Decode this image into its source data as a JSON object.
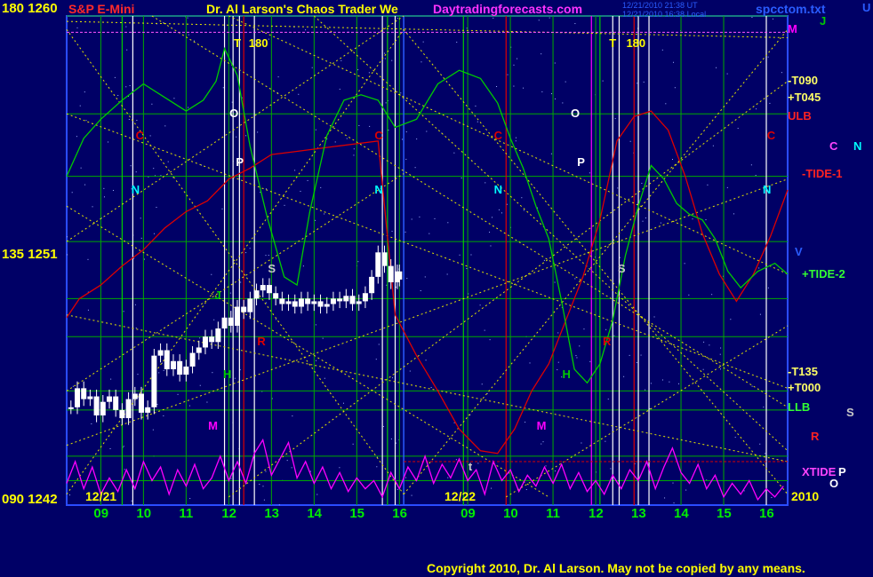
{
  "header": {
    "axis_top": "180 1260",
    "instrument": "S&P E-Mini",
    "title": "Dr. Al Larson's Chaos Trader We",
    "site": "Daytradingforecasts.com",
    "timestamp_ut": "12/21/2010 21:38 UT",
    "timestamp_local": "12/21/2010 16:38 Local",
    "file": "spcctom.txt"
  },
  "y_labels": {
    "top": "180 1260",
    "mid": "135 1251",
    "bottom": "090 1242"
  },
  "date_labels": {
    "left": "12/21",
    "right": "12/22",
    "year": "2010"
  },
  "footer": {
    "copyright": "Copyright 2010, Dr. Al Larson. May not be copied by any means."
  },
  "colors": {
    "background": "#000066",
    "grid": "#00aa00",
    "price": "#ffffff",
    "green_line": "#00cc00",
    "red_line": "#dd0000",
    "magenta_line": "#ff00ff",
    "dotted_fan": "#e6e600"
  },
  "chart_data": {
    "type": "line",
    "title": "Dr. Al Larson's Chaos Trader We",
    "instrument": "S&P E-Mini",
    "y_axis": {
      "range": [
        1242,
        1260
      ],
      "ticks": [
        1242,
        1251,
        1260
      ],
      "angle_ticks": [
        "090",
        "135",
        "180"
      ]
    },
    "x_axis": {
      "unit": "hour",
      "range": [
        8.2,
        17.2
      ],
      "tick_labels": [
        "09",
        "10",
        "11",
        "12",
        "13",
        "14",
        "15",
        "16",
        "09",
        "10",
        "11",
        "12",
        "13",
        "14",
        "15",
        "16"
      ],
      "ticks_day1": [
        9,
        10,
        11,
        12,
        13,
        14,
        15,
        16
      ],
      "ticks_day2": [
        9,
        10,
        11,
        12,
        13,
        14,
        15,
        16
      ],
      "day_split": 16.1
    },
    "grid": true,
    "horizontal_grid_values": [
      1243.8,
      1249.6,
      1251.7,
      1254.1,
      1256.4,
      1260,
      1245.5,
      1242.9,
      1248.2,
      1246.2
    ],
    "price_series": {
      "name": "S&P E-Mini",
      "x": [
        8.3,
        8.45,
        8.6,
        8.75,
        8.9,
        9.05,
        9.2,
        9.35,
        9.5,
        9.65,
        9.8,
        9.95,
        10.1,
        10.25,
        10.4,
        10.55,
        10.7,
        10.85,
        11.0,
        11.15,
        11.3,
        11.45,
        11.6,
        11.75,
        11.9,
        12.05,
        12.2,
        12.35,
        12.5,
        12.65,
        12.8,
        12.95,
        13.1,
        13.25,
        13.4,
        13.55,
        13.7,
        13.85,
        14.0,
        14.15,
        14.3,
        14.45,
        14.6,
        14.75,
        14.9,
        15.05,
        15.2,
        15.35,
        15.5,
        15.65,
        15.8,
        15.95,
        16.0
      ],
      "values": [
        1245.6,
        1246.3,
        1245.9,
        1246.0,
        1245.3,
        1245.8,
        1246.0,
        1245.5,
        1245.2,
        1245.9,
        1246.1,
        1245.4,
        1245.6,
        1247.5,
        1247.7,
        1247.0,
        1247.3,
        1246.8,
        1247.1,
        1247.6,
        1247.8,
        1248.2,
        1248.0,
        1248.5,
        1248.9,
        1248.6,
        1249.3,
        1249.1,
        1249.6,
        1249.9,
        1250.1,
        1249.8,
        1249.6,
        1249.4,
        1249.5,
        1249.3,
        1249.6,
        1249.4,
        1249.5,
        1249.3,
        1249.4,
        1249.6,
        1249.5,
        1249.7,
        1249.4,
        1249.5,
        1249.8,
        1250.4,
        1251.3,
        1250.8,
        1250.2,
        1250.6,
        1250.3
      ]
    },
    "green_line": {
      "x": [
        8.2,
        8.6,
        9.0,
        9.5,
        10.0,
        10.5,
        11.0,
        11.4,
        11.7,
        11.9,
        12.2,
        12.5,
        12.9,
        13.3,
        13.6,
        13.9,
        14.3,
        14.7,
        15.1,
        15.5,
        15.9,
        16.4,
        16.9,
        17.4,
        17.9,
        18.3,
        18.6,
        18.9,
        19.2,
        19.5,
        19.8,
        20.1,
        20.4,
        20.7,
        21.0,
        21.3,
        21.6,
        21.9,
        22.2,
        22.5,
        22.8,
        23.1,
        23.4,
        23.7,
        24.0,
        24.4,
        24.8,
        25.1
      ],
      "values": [
        1254.1,
        1255.5,
        1256.2,
        1256.9,
        1257.5,
        1257.0,
        1256.5,
        1256.9,
        1257.6,
        1258.8,
        1257.8,
        1255.2,
        1252.6,
        1250.4,
        1250.1,
        1252.8,
        1255.6,
        1256.9,
        1257.1,
        1256.9,
        1255.9,
        1256.2,
        1257.5,
        1258.0,
        1257.7,
        1256.8,
        1255.5,
        1254.4,
        1253.0,
        1251.8,
        1249.5,
        1247.0,
        1246.5,
        1247.2,
        1248.8,
        1251.2,
        1253.0,
        1254.5,
        1254.0,
        1253.1,
        1252.7,
        1252.5,
        1251.8,
        1250.6,
        1250.0,
        1250.6,
        1250.9,
        1250.5
      ]
    },
    "red_line": {
      "x": [
        8.2,
        8.5,
        9.0,
        9.5,
        10.0,
        10.5,
        11.0,
        11.5,
        12.0,
        12.5,
        13.0,
        13.5,
        14.0,
        14.5,
        15.0,
        15.5,
        15.9,
        16.4,
        16.9,
        17.4,
        17.9,
        18.3,
        18.7,
        19.1,
        19.5,
        19.9,
        20.3,
        20.7,
        21.1,
        21.5,
        21.9,
        22.3,
        22.7,
        23.1,
        23.5,
        23.9,
        24.3,
        24.7,
        25.1
      ],
      "values": [
        1248.9,
        1249.6,
        1250.1,
        1250.8,
        1251.4,
        1252.2,
        1252.8,
        1253.2,
        1254.0,
        1254.4,
        1254.9,
        1255.0,
        1255.1,
        1255.2,
        1255.3,
        1255.4,
        1249.0,
        1247.5,
        1246.2,
        1244.8,
        1244.0,
        1243.9,
        1244.8,
        1246.2,
        1247.2,
        1248.8,
        1250.4,
        1252.5,
        1255.4,
        1256.3,
        1256.5,
        1255.8,
        1254.1,
        1252.0,
        1250.5,
        1249.5,
        1250.5,
        1251.9,
        1253.6
      ]
    },
    "magenta_line": {
      "x": [
        8.2,
        8.4,
        8.6,
        8.8,
        9.0,
        9.2,
        9.4,
        9.6,
        9.8,
        10.0,
        10.2,
        10.4,
        10.6,
        10.8,
        11.0,
        11.2,
        11.4,
        11.6,
        11.8,
        12.0,
        12.2,
        12.4,
        12.6,
        12.8,
        13.0,
        13.2,
        13.4,
        13.6,
        13.8,
        14.0,
        14.2,
        14.4,
        14.6,
        14.8,
        15.0,
        15.2,
        15.4,
        15.6,
        15.8,
        16.0,
        16.2,
        16.4,
        16.6,
        16.8,
        17.0,
        17.2,
        17.4,
        17.6,
        17.8,
        18.0,
        18.2,
        18.4,
        18.6,
        18.8,
        19.0,
        19.2,
        19.4,
        19.6,
        19.8,
        20.0,
        20.2,
        20.4,
        20.6,
        20.8,
        21.0,
        21.2,
        21.4,
        21.6,
        21.8,
        22.0,
        22.2,
        22.4,
        22.6,
        22.8,
        23.0,
        23.2,
        23.4,
        23.6,
        23.8,
        24.0,
        24.2,
        24.4,
        24.6,
        24.8,
        25.0
      ],
      "values": [
        1242.8,
        1243.6,
        1242.6,
        1243.4,
        1242.4,
        1243.0,
        1242.5,
        1243.3,
        1242.6,
        1243.6,
        1242.9,
        1243.4,
        1242.4,
        1243.3,
        1242.7,
        1243.5,
        1242.6,
        1243.0,
        1243.8,
        1242.9,
        1243.6,
        1242.8,
        1243.9,
        1244.4,
        1243.1,
        1243.7,
        1244.3,
        1243.0,
        1243.6,
        1242.8,
        1243.4,
        1242.6,
        1243.2,
        1242.5,
        1243.0,
        1242.6,
        1242.9,
        1242.3,
        1243.2,
        1242.6,
        1243.4,
        1242.9,
        1243.8,
        1242.8,
        1243.5,
        1243.0,
        1243.7,
        1242.9,
        1243.3,
        1242.4,
        1243.6,
        1242.9,
        1243.3,
        1242.5,
        1243.1,
        1242.7,
        1243.4,
        1242.8,
        1243.5,
        1242.6,
        1243.2,
        1242.5,
        1242.9,
        1242.4,
        1243.1,
        1242.6,
        1243.3,
        1242.9,
        1243.6,
        1242.6,
        1243.4,
        1244.1,
        1243.2,
        1242.8,
        1243.5,
        1242.6,
        1243.1,
        1242.3,
        1242.8,
        1242.4,
        1242.9,
        1242.2,
        1242.6,
        1242.3,
        1242.7
      ]
    },
    "vertical_lines": [
      {
        "x": 9.5,
        "color": "#00cc00"
      },
      {
        "x": 9.75,
        "color": "#ffffff"
      },
      {
        "x": 11.9,
        "color": "#ffffff"
      },
      {
        "x": 12.1,
        "color": "#ffffff"
      },
      {
        "x": 12.25,
        "color": "#ffffff"
      },
      {
        "x": 12.35,
        "color": "#dd0000"
      },
      {
        "x": 12.6,
        "color": "#ffffff"
      },
      {
        "x": 15.6,
        "color": "#ffffff"
      },
      {
        "x": 15.72,
        "color": "#00cc00"
      },
      {
        "x": 15.9,
        "color": "#ffffff"
      },
      {
        "x": 17.5,
        "color": "#00cc00"
      },
      {
        "x": 18.5,
        "color": "#dd0000"
      },
      {
        "x": 20.5,
        "color": "#ff00ff"
      },
      {
        "x": 20.7,
        "color": "#00cc00"
      },
      {
        "x": 21.0,
        "color": "#ffffff"
      },
      {
        "x": 21.15,
        "color": "#ffffff"
      },
      {
        "x": 21.5,
        "color": "#dd0000"
      },
      {
        "x": 21.6,
        "color": "#ffffff"
      },
      {
        "x": 21.85,
        "color": "#ffffff"
      },
      {
        "x": 24.6,
        "color": "#ffffff"
      }
    ],
    "right_labels": [
      {
        "text": "M",
        "y": 1259.5,
        "color": "#ff00ff"
      },
      {
        "text": "J",
        "y": 1259.8,
        "color": "#00cc00"
      },
      {
        "text": "U",
        "y": 1260.3,
        "color": "#2a5cff"
      },
      {
        "text": "-T090",
        "y": 1257.6,
        "color": "#ffff66"
      },
      {
        "text": "+T045",
        "y": 1257.0,
        "color": "#ffff66"
      },
      {
        "text": "ULB",
        "y": 1256.3,
        "color": "#ff2222"
      },
      {
        "text": "C",
        "y": 1255.2,
        "color": "#ff44ff"
      },
      {
        "text": "N",
        "y": 1255.2,
        "color": "#00ffff"
      },
      {
        "text": "-TIDE-1",
        "y": 1254.2,
        "color": "#ff2222"
      },
      {
        "text": "V",
        "y": 1251.3,
        "color": "#2a5cff"
      },
      {
        "text": "+TIDE-2",
        "y": 1250.5,
        "color": "#33ff33"
      },
      {
        "text": "-T135",
        "y": 1246.9,
        "color": "#ffff66"
      },
      {
        "text": "+T000",
        "y": 1246.3,
        "color": "#ffff66"
      },
      {
        "text": "LLB",
        "y": 1245.6,
        "color": "#33ff33"
      },
      {
        "text": "S",
        "y": 1245.4,
        "color": "#c8c8c8"
      },
      {
        "text": "R",
        "y": 1244.5,
        "color": "#ff2222"
      },
      {
        "text": "XTIDE",
        "y": 1243.2,
        "color": "#ff44ff"
      },
      {
        "text": "P",
        "y": 1243.2,
        "color": "#ffffff"
      },
      {
        "text": "O",
        "y": 1242.8,
        "color": "#ffffff"
      }
    ],
    "marker_labels": [
      {
        "text": "T",
        "x": 12.2,
        "y": 1259.0,
        "color": "#ffff00"
      },
      {
        "text": "180",
        "x": 12.55,
        "y": 1259.0,
        "color": "#ffff00"
      },
      {
        "text": "T",
        "x": 21.0,
        "y": 1259.0,
        "color": "#ffff00"
      },
      {
        "text": "180",
        "x": 21.4,
        "y": 1259.0,
        "color": "#ffff00"
      },
      {
        "text": "O",
        "x": 12.1,
        "y": 1256.4,
        "color": "#ffffff"
      },
      {
        "text": "O",
        "x": 20.1,
        "y": 1256.4,
        "color": "#ffffff"
      },
      {
        "text": "C",
        "x": 9.9,
        "y": 1255.6,
        "color": "#dd0000"
      },
      {
        "text": "C",
        "x": 15.5,
        "y": 1255.6,
        "color": "#dd0000"
      },
      {
        "text": "C",
        "x": 18.3,
        "y": 1255.6,
        "color": "#dd0000"
      },
      {
        "text": "C",
        "x": 24.7,
        "y": 1255.6,
        "color": "#dd0000"
      },
      {
        "text": "P",
        "x": 12.25,
        "y": 1254.6,
        "color": "#ffffff"
      },
      {
        "text": "P",
        "x": 20.25,
        "y": 1254.6,
        "color": "#ffffff"
      },
      {
        "text": "N",
        "x": 9.8,
        "y": 1253.6,
        "color": "#00ffff"
      },
      {
        "text": "N",
        "x": 15.5,
        "y": 1253.6,
        "color": "#00ffff"
      },
      {
        "text": "N",
        "x": 18.3,
        "y": 1253.6,
        "color": "#00ffff"
      },
      {
        "text": "N",
        "x": 24.6,
        "y": 1253.6,
        "color": "#00ffff"
      },
      {
        "text": "S",
        "x": 13.0,
        "y": 1250.7,
        "color": "#c8c8c8"
      },
      {
        "text": "S",
        "x": 21.2,
        "y": 1250.7,
        "color": "#c8c8c8"
      },
      {
        "text": "J",
        "x": 11.75,
        "y": 1249.7,
        "color": "#00cc00"
      },
      {
        "text": "R",
        "x": 12.75,
        "y": 1248.0,
        "color": "#dd0000"
      },
      {
        "text": "R",
        "x": 20.85,
        "y": 1248.0,
        "color": "#dd0000"
      },
      {
        "text": "H",
        "x": 11.95,
        "y": 1246.8,
        "color": "#00cc00"
      },
      {
        "text": "H",
        "x": 19.9,
        "y": 1246.8,
        "color": "#00cc00"
      },
      {
        "text": "M",
        "x": 11.6,
        "y": 1244.9,
        "color": "#ff00ff"
      },
      {
        "text": "M",
        "x": 19.3,
        "y": 1244.9,
        "color": "#ff00ff"
      },
      {
        "text": "t",
        "x": 17.7,
        "y": 1243.4,
        "color": "#c8c8c8"
      }
    ]
  }
}
